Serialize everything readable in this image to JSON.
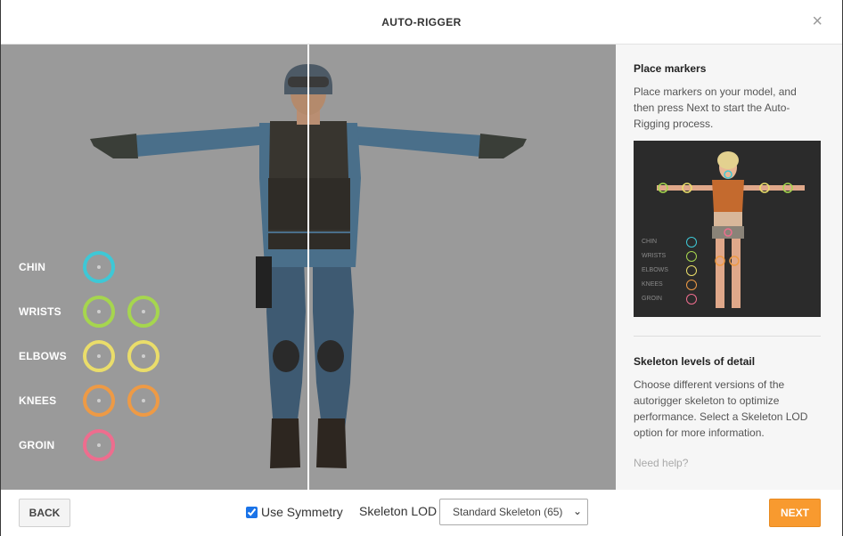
{
  "dialog": {
    "title": "AUTO-RIGGER",
    "close_glyph": "×"
  },
  "markers": [
    {
      "label": "CHIN",
      "color": "#3ec8d6",
      "count": 1
    },
    {
      "label": "WRISTS",
      "color": "#a6d64e",
      "count": 2
    },
    {
      "label": "ELBOWS",
      "color": "#eadd6a",
      "count": 2
    },
    {
      "label": "KNEES",
      "color": "#ee9a45",
      "count": 2
    },
    {
      "label": "GROIN",
      "color": "#ee6d8e",
      "count": 1
    }
  ],
  "sidepanel": {
    "place_heading": "Place markers",
    "place_text": "Place markers on your model, and then press Next to start the Auto-Rigging process.",
    "preview_legend": [
      "CHIN",
      "WRISTS",
      "ELBOWS",
      "KNEES",
      "GROIN"
    ],
    "lod_heading": "Skeleton levels of detail",
    "lod_text": "Choose different versions of the autorigger skeleton to optimize performance. Select a Skeleton LOD option for more information.",
    "help_link": "Need help?"
  },
  "footer": {
    "back_label": "BACK",
    "symmetry_label": "Use Symmetry",
    "symmetry_checked": true,
    "lod_label": "Skeleton LOD",
    "lod_selected": "Standard Skeleton (65)",
    "next_label": "NEXT"
  },
  "colors": {
    "viewport_bg": "#9a9a9a",
    "accent_next": "#f89a2f",
    "panel_bg": "#f6f6f6"
  },
  "icons": [
    "close-icon",
    "chevron-down-icon",
    "checkbox-icon"
  ]
}
